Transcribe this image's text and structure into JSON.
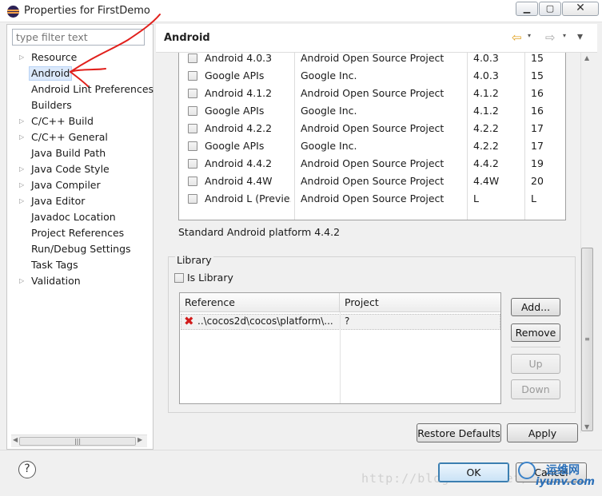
{
  "window": {
    "title": "Properties for FirstDemo",
    "controls": {
      "minimize": "▁",
      "maximize": "▢",
      "close": "✕"
    }
  },
  "left": {
    "filter_placeholder": "type filter text",
    "tree": [
      {
        "label": "Resource",
        "expandable": true
      },
      {
        "label": "Android",
        "expandable": false,
        "selected": true
      },
      {
        "label": "Android Lint Preferences",
        "expandable": false
      },
      {
        "label": "Builders",
        "expandable": false
      },
      {
        "label": "C/C++ Build",
        "expandable": true
      },
      {
        "label": "C/C++ General",
        "expandable": true
      },
      {
        "label": "Java Build Path",
        "expandable": false
      },
      {
        "label": "Java Code Style",
        "expandable": true
      },
      {
        "label": "Java Compiler",
        "expandable": true
      },
      {
        "label": "Java Editor",
        "expandable": true
      },
      {
        "label": "Javadoc Location",
        "expandable": false
      },
      {
        "label": "Project References",
        "expandable": false
      },
      {
        "label": "Run/Debug Settings",
        "expandable": false
      },
      {
        "label": "Task Tags",
        "expandable": false
      },
      {
        "label": "Validation",
        "expandable": true
      }
    ],
    "scroll_thumb": "|||"
  },
  "right": {
    "title": "Android",
    "nav": {
      "back": "⇦",
      "forward": "⇨",
      "dropdown": "▾",
      "menu": "▾"
    },
    "targets": [
      {
        "name": "Android 4.0.3",
        "vendor": "Android Open Source Project",
        "platform": "4.0.3",
        "api": "15"
      },
      {
        "name": "Google APIs",
        "vendor": "Google Inc.",
        "platform": "4.0.3",
        "api": "15"
      },
      {
        "name": "Android 4.1.2",
        "vendor": "Android Open Source Project",
        "platform": "4.1.2",
        "api": "16"
      },
      {
        "name": "Google APIs",
        "vendor": "Google Inc.",
        "platform": "4.1.2",
        "api": "16"
      },
      {
        "name": "Android 4.2.2",
        "vendor": "Android Open Source Project",
        "platform": "4.2.2",
        "api": "17"
      },
      {
        "name": "Google APIs",
        "vendor": "Google Inc.",
        "platform": "4.2.2",
        "api": "17"
      },
      {
        "name": "Android 4.4.2",
        "vendor": "Android Open Source Project",
        "platform": "4.4.2",
        "api": "19"
      },
      {
        "name": "Android 4.4W",
        "vendor": "Android Open Source Project",
        "platform": "4.4W",
        "api": "20"
      },
      {
        "name": "Android L (Previe...",
        "vendor": "Android Open Source Project",
        "platform": "L",
        "api": "L"
      }
    ],
    "platform_text": "Standard Android platform 4.4.2",
    "library": {
      "group_label": "Library",
      "is_library_label": "Is Library",
      "columns": {
        "reference": "Reference",
        "project": "Project"
      },
      "rows": [
        {
          "reference": "..\\cocos2d\\cocos\\platform\\...",
          "project": "?"
        }
      ],
      "buttons": {
        "add": "Add...",
        "remove": "Remove",
        "up": "Up",
        "down": "Down"
      }
    },
    "restore_defaults": "Restore Defaults",
    "apply": "Apply",
    "scroll_thumb": "≡"
  },
  "bottom": {
    "help": "?",
    "ok": "OK",
    "cancel": "Cancel"
  },
  "watermark": {
    "url": "http://blog.csdn.net/",
    "logo_top": "运维网",
    "logo": "iyunv.com"
  }
}
